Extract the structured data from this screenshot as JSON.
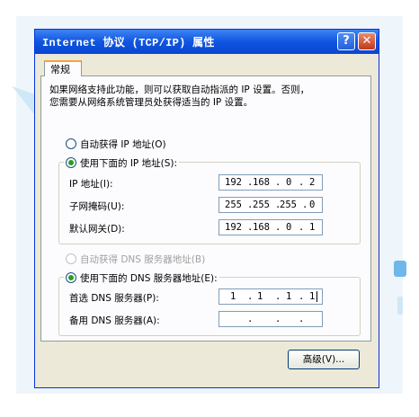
{
  "window": {
    "title": "Internet 协议 (TCP/IP) 属性",
    "help_label": "?",
    "close_label": "✕"
  },
  "tabs": [
    {
      "label": "常规",
      "selected": true
    }
  ],
  "intro": {
    "line1": "如果网络支持此功能，则可以获取自动指派的 IP 设置。否则，",
    "line2": "您需要从网络系统管理员处获得适当的 IP 设置。"
  },
  "ip_section": {
    "auto_option": {
      "label": "自动获得 IP 地址(O)",
      "checked": false
    },
    "manual_option": {
      "label": "使用下面的 IP 地址(S):",
      "checked": true
    },
    "fields": [
      {
        "label": "IP 地址(I):",
        "octets": [
          "192",
          "168",
          "0",
          "2"
        ]
      },
      {
        "label": "子网掩码(U):",
        "octets": [
          "255",
          "255",
          "255",
          "0"
        ]
      },
      {
        "label": "默认网关(D):",
        "octets": [
          "192",
          "168",
          "0",
          "1"
        ]
      }
    ]
  },
  "dns_section": {
    "auto_option": {
      "label": "自动获得 DNS 服务器地址(B)",
      "checked": false,
      "enabled": false
    },
    "manual_option": {
      "label": "使用下面的 DNS 服务器地址(E):",
      "checked": true
    },
    "fields": [
      {
        "label": "首选 DNS 服务器(P):",
        "octets": [
          "1",
          "1",
          "1",
          "1"
        ]
      },
      {
        "label": "备用 DNS 服务器(A):",
        "octets": [
          "",
          "",
          "",
          ""
        ]
      }
    ]
  },
  "advanced_label": "高级(V)...",
  "colors": {
    "title_bar": "#0f55e0",
    "dialog_bg": "#ece9d8",
    "tab_accent": "#f7a23c",
    "radio_dot": "#21a121"
  }
}
